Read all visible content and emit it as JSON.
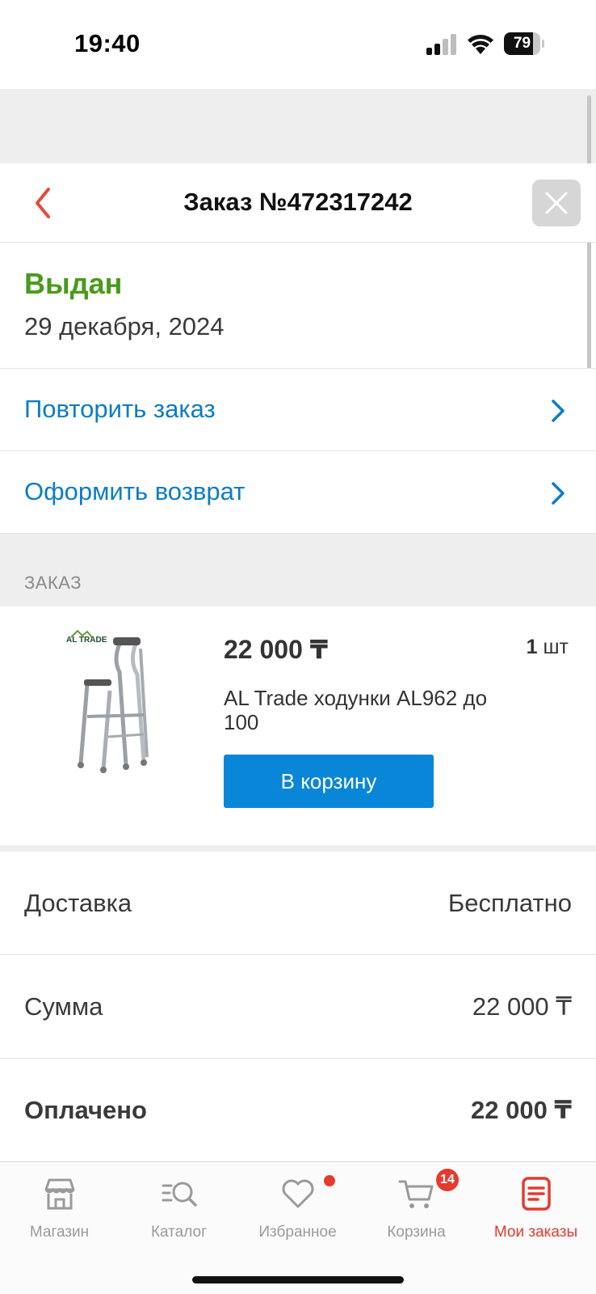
{
  "status_bar": {
    "time": "19:40",
    "battery": "79",
    "battery_level": 0.79
  },
  "header": {
    "title": "Заказ №472317242",
    "back_icon": "chevron-left-icon",
    "close_icon": "close-icon"
  },
  "order_status": {
    "status": "Выдан",
    "date": "29 декабря, 2024",
    "color": "#4a9a1c"
  },
  "actions": [
    {
      "label": "Повторить заказ"
    },
    {
      "label": "Оформить возврат"
    }
  ],
  "section_title": "ЗАКАЗ",
  "product": {
    "brand": "AL TRADE",
    "price": "22 000 ₸",
    "qty_number": "1",
    "qty_unit": "шт",
    "name": "AL Trade ходунки AL962 до 100",
    "cart_button": "В корзину"
  },
  "summary": [
    {
      "label": "Доставка",
      "value": "Бесплатно"
    },
    {
      "label": "Сумма",
      "value": "22 000 ₸"
    },
    {
      "label": "Оплачено",
      "value": "22 000 ₸"
    }
  ],
  "tabs": [
    {
      "label": "Магазин",
      "icon": "shop-icon"
    },
    {
      "label": "Каталог",
      "icon": "catalog-search-icon"
    },
    {
      "label": "Избранное",
      "icon": "heart-icon"
    },
    {
      "label": "Корзина",
      "icon": "cart-icon",
      "badge": "14"
    },
    {
      "label": "Мои заказы",
      "icon": "orders-icon",
      "active": true
    }
  ],
  "colors": {
    "accent_blue": "#0a86d8",
    "link_blue": "#0d7cc6",
    "active_red": "#e63a2e",
    "status_green": "#4a9a1c"
  }
}
